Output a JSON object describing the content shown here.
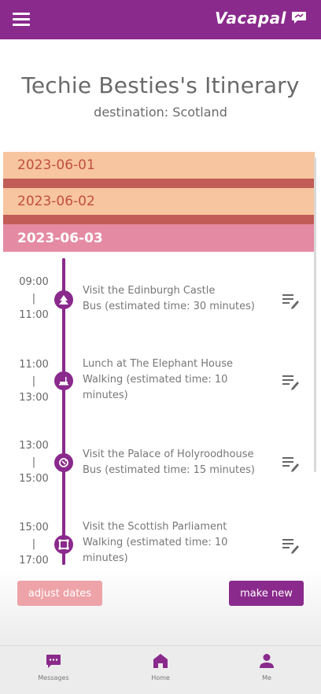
{
  "header": {
    "brand": "Vacapal",
    "colors": {
      "primary": "#8a2a8c",
      "date_collapsed": "#f7c59f",
      "date_active": "#e58aa3"
    },
    "icons": {
      "menu": "hamburger-menu-icon",
      "brand": "chat-bubble-icon"
    }
  },
  "itinerary": {
    "title": "Techie Besties's Itinerary",
    "destination": "destination: Scotland"
  },
  "dates": [
    {
      "label": "2023-06-01",
      "state": "collapsed"
    },
    {
      "label": "2023-06-02",
      "state": "collapsed"
    },
    {
      "label": "2023-06-03",
      "state": "expanded"
    }
  ],
  "events": [
    {
      "start": "09:00",
      "sep": "|",
      "end": "11:00",
      "title": "Visit the Edinburgh Castle",
      "transport": "Bus (estimated time: 30 minutes)",
      "icon": "castle-icon"
    },
    {
      "start": "11:00",
      "sep": "|",
      "end": "13:00",
      "title": "Lunch at The Elephant House",
      "transport": "Walking (estimated time: 10 minutes)",
      "icon": "dining-icon"
    },
    {
      "start": "13:00",
      "sep": "|",
      "end": "15:00",
      "title": "Visit the Palace of Holyroodhouse",
      "transport": "Bus (estimated time: 15 minutes)",
      "icon": "landmark-icon"
    },
    {
      "start": "15:00",
      "sep": "|",
      "end": "17:00",
      "title": "Visit the Scottish Parliament",
      "transport": "Walking (estimated time: 10 minutes)",
      "icon": "building-icon"
    }
  ],
  "actions": {
    "adjust": "adjust dates",
    "make_new": "make new"
  },
  "tabs": [
    {
      "label": "Messages",
      "icon": "messages-icon"
    },
    {
      "label": "Home",
      "icon": "home-icon"
    },
    {
      "label": "Me",
      "icon": "user-icon"
    }
  ]
}
